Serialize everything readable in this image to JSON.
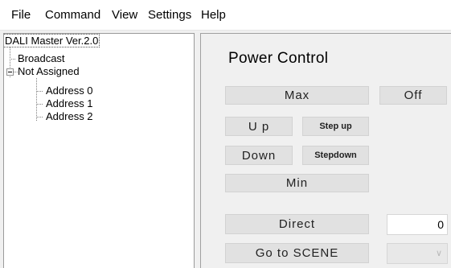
{
  "menu": {
    "file": "File",
    "command": "Command",
    "view": "View",
    "settings": "Settings",
    "help": "Help"
  },
  "tree": {
    "root": "DALI Master Ver.2.0",
    "broadcast": "Broadcast",
    "not_assigned": "Not Assigned",
    "addresses": [
      "Address 0",
      "Address 1",
      "Address 2"
    ]
  },
  "power_control": {
    "title": "Power Control",
    "max": "Max",
    "off": "Off",
    "up": "U p",
    "step_up": "Step up",
    "down": "Down",
    "step_down": "Stepdown",
    "min": "Min",
    "direct": "Direct",
    "direct_value": "0",
    "go_to_scene": "Go to SCENE",
    "scene_selected": ""
  },
  "icons": {
    "expander": "minus-box-icon",
    "dropdown": "chevron-down-icon"
  }
}
